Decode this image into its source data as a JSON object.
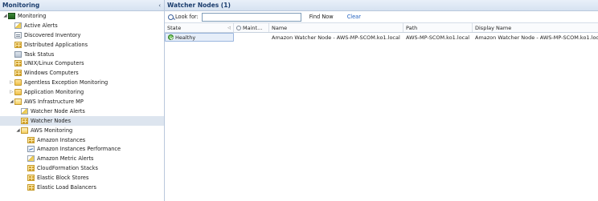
{
  "nav": {
    "title": "Monitoring",
    "collapse_glyph": "‹",
    "items": [
      {
        "label": "Monitoring",
        "icon": "monitor-icon",
        "expander": "◢",
        "indent": 0
      },
      {
        "label": "Active Alerts",
        "icon": "alert-view-icon",
        "expander": "",
        "indent": 1
      },
      {
        "label": "Discovered Inventory",
        "icon": "list-view-icon",
        "expander": "",
        "indent": 1
      },
      {
        "label": "Distributed Applications",
        "icon": "state-view-icon",
        "expander": "",
        "indent": 1
      },
      {
        "label": "Task Status",
        "icon": "task-view-icon",
        "expander": "",
        "indent": 1
      },
      {
        "label": "UNIX/Linux Computers",
        "icon": "state-view-icon",
        "expander": "",
        "indent": 1
      },
      {
        "label": "Windows Computers",
        "icon": "state-view-icon",
        "expander": "",
        "indent": 1
      },
      {
        "label": "Agentless Exception Monitoring",
        "icon": "folder-icon",
        "expander": "▷",
        "indent": 1
      },
      {
        "label": "Application Monitoring",
        "icon": "folder-icon",
        "expander": "▷",
        "indent": 1
      },
      {
        "label": "AWS Infrastructure MP",
        "icon": "folder-open-icon",
        "expander": "◢",
        "indent": 1
      },
      {
        "label": "Watcher Node Alerts",
        "icon": "alert-view-icon",
        "expander": "",
        "indent": 2
      },
      {
        "label": "Watcher Nodes",
        "icon": "state-view-icon",
        "expander": "",
        "indent": 2,
        "selected": true
      },
      {
        "label": "AWS Monitoring",
        "icon": "folder-open-icon",
        "expander": "◢",
        "indent": 2
      },
      {
        "label": "Amazon Instances",
        "icon": "state-view-icon",
        "expander": "",
        "indent": 3
      },
      {
        "label": "Amazon Instances Performance",
        "icon": "performance-view-icon",
        "expander": "",
        "indent": 3
      },
      {
        "label": "Amazon Metric Alerts",
        "icon": "alert-view-icon",
        "expander": "",
        "indent": 3
      },
      {
        "label": "CloudFormation Stacks",
        "icon": "state-view-icon",
        "expander": "",
        "indent": 3
      },
      {
        "label": "Elastic Block Stores",
        "icon": "state-view-icon",
        "expander": "",
        "indent": 3
      },
      {
        "label": "Elastic Load Balancers",
        "icon": "state-view-icon",
        "expander": "",
        "indent": 3
      }
    ]
  },
  "main": {
    "title": "Watcher Nodes (1)",
    "toolbar": {
      "look_for_label": "Look for:",
      "search_value": "",
      "find_now_label": "Find Now",
      "clear_label": "Clear"
    },
    "columns": [
      "State",
      "Maint...",
      "Name",
      "Path",
      "Display Name"
    ],
    "rows": [
      {
        "state": "Healthy",
        "maint": "",
        "name": "Amazon Watcher Node - AWS-MP-SCOM.ko1.local",
        "path": "AWS-MP-SCOM.ko1.local",
        "display_name": "Amazon Watcher Node - AWS-MP-SCOM.ko1.local"
      }
    ]
  },
  "colors": {
    "header_text": "#1b3d6e",
    "selection_bg": "#dde5ef",
    "link": "#1f5fbf",
    "healthy": "#3a9a2a"
  }
}
